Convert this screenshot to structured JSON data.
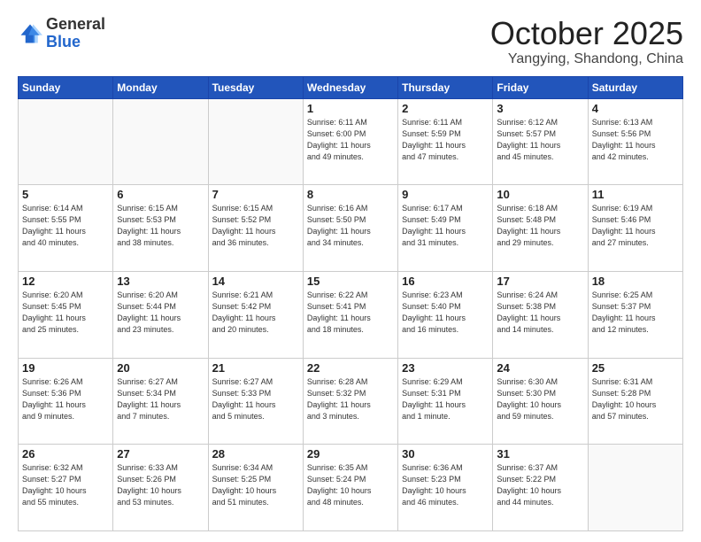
{
  "header": {
    "logo_general": "General",
    "logo_blue": "Blue",
    "month": "October 2025",
    "location": "Yangying, Shandong, China"
  },
  "weekdays": [
    "Sunday",
    "Monday",
    "Tuesday",
    "Wednesday",
    "Thursday",
    "Friday",
    "Saturday"
  ],
  "weeks": [
    [
      {
        "day": "",
        "info": ""
      },
      {
        "day": "",
        "info": ""
      },
      {
        "day": "",
        "info": ""
      },
      {
        "day": "1",
        "info": "Sunrise: 6:11 AM\nSunset: 6:00 PM\nDaylight: 11 hours\nand 49 minutes."
      },
      {
        "day": "2",
        "info": "Sunrise: 6:11 AM\nSunset: 5:59 PM\nDaylight: 11 hours\nand 47 minutes."
      },
      {
        "day": "3",
        "info": "Sunrise: 6:12 AM\nSunset: 5:57 PM\nDaylight: 11 hours\nand 45 minutes."
      },
      {
        "day": "4",
        "info": "Sunrise: 6:13 AM\nSunset: 5:56 PM\nDaylight: 11 hours\nand 42 minutes."
      }
    ],
    [
      {
        "day": "5",
        "info": "Sunrise: 6:14 AM\nSunset: 5:55 PM\nDaylight: 11 hours\nand 40 minutes."
      },
      {
        "day": "6",
        "info": "Sunrise: 6:15 AM\nSunset: 5:53 PM\nDaylight: 11 hours\nand 38 minutes."
      },
      {
        "day": "7",
        "info": "Sunrise: 6:15 AM\nSunset: 5:52 PM\nDaylight: 11 hours\nand 36 minutes."
      },
      {
        "day": "8",
        "info": "Sunrise: 6:16 AM\nSunset: 5:50 PM\nDaylight: 11 hours\nand 34 minutes."
      },
      {
        "day": "9",
        "info": "Sunrise: 6:17 AM\nSunset: 5:49 PM\nDaylight: 11 hours\nand 31 minutes."
      },
      {
        "day": "10",
        "info": "Sunrise: 6:18 AM\nSunset: 5:48 PM\nDaylight: 11 hours\nand 29 minutes."
      },
      {
        "day": "11",
        "info": "Sunrise: 6:19 AM\nSunset: 5:46 PM\nDaylight: 11 hours\nand 27 minutes."
      }
    ],
    [
      {
        "day": "12",
        "info": "Sunrise: 6:20 AM\nSunset: 5:45 PM\nDaylight: 11 hours\nand 25 minutes."
      },
      {
        "day": "13",
        "info": "Sunrise: 6:20 AM\nSunset: 5:44 PM\nDaylight: 11 hours\nand 23 minutes."
      },
      {
        "day": "14",
        "info": "Sunrise: 6:21 AM\nSunset: 5:42 PM\nDaylight: 11 hours\nand 20 minutes."
      },
      {
        "day": "15",
        "info": "Sunrise: 6:22 AM\nSunset: 5:41 PM\nDaylight: 11 hours\nand 18 minutes."
      },
      {
        "day": "16",
        "info": "Sunrise: 6:23 AM\nSunset: 5:40 PM\nDaylight: 11 hours\nand 16 minutes."
      },
      {
        "day": "17",
        "info": "Sunrise: 6:24 AM\nSunset: 5:38 PM\nDaylight: 11 hours\nand 14 minutes."
      },
      {
        "day": "18",
        "info": "Sunrise: 6:25 AM\nSunset: 5:37 PM\nDaylight: 11 hours\nand 12 minutes."
      }
    ],
    [
      {
        "day": "19",
        "info": "Sunrise: 6:26 AM\nSunset: 5:36 PM\nDaylight: 11 hours\nand 9 minutes."
      },
      {
        "day": "20",
        "info": "Sunrise: 6:27 AM\nSunset: 5:34 PM\nDaylight: 11 hours\nand 7 minutes."
      },
      {
        "day": "21",
        "info": "Sunrise: 6:27 AM\nSunset: 5:33 PM\nDaylight: 11 hours\nand 5 minutes."
      },
      {
        "day": "22",
        "info": "Sunrise: 6:28 AM\nSunset: 5:32 PM\nDaylight: 11 hours\nand 3 minutes."
      },
      {
        "day": "23",
        "info": "Sunrise: 6:29 AM\nSunset: 5:31 PM\nDaylight: 11 hours\nand 1 minute."
      },
      {
        "day": "24",
        "info": "Sunrise: 6:30 AM\nSunset: 5:30 PM\nDaylight: 10 hours\nand 59 minutes."
      },
      {
        "day": "25",
        "info": "Sunrise: 6:31 AM\nSunset: 5:28 PM\nDaylight: 10 hours\nand 57 minutes."
      }
    ],
    [
      {
        "day": "26",
        "info": "Sunrise: 6:32 AM\nSunset: 5:27 PM\nDaylight: 10 hours\nand 55 minutes."
      },
      {
        "day": "27",
        "info": "Sunrise: 6:33 AM\nSunset: 5:26 PM\nDaylight: 10 hours\nand 53 minutes."
      },
      {
        "day": "28",
        "info": "Sunrise: 6:34 AM\nSunset: 5:25 PM\nDaylight: 10 hours\nand 51 minutes."
      },
      {
        "day": "29",
        "info": "Sunrise: 6:35 AM\nSunset: 5:24 PM\nDaylight: 10 hours\nand 48 minutes."
      },
      {
        "day": "30",
        "info": "Sunrise: 6:36 AM\nSunset: 5:23 PM\nDaylight: 10 hours\nand 46 minutes."
      },
      {
        "day": "31",
        "info": "Sunrise: 6:37 AM\nSunset: 5:22 PM\nDaylight: 10 hours\nand 44 minutes."
      },
      {
        "day": "",
        "info": ""
      }
    ]
  ]
}
